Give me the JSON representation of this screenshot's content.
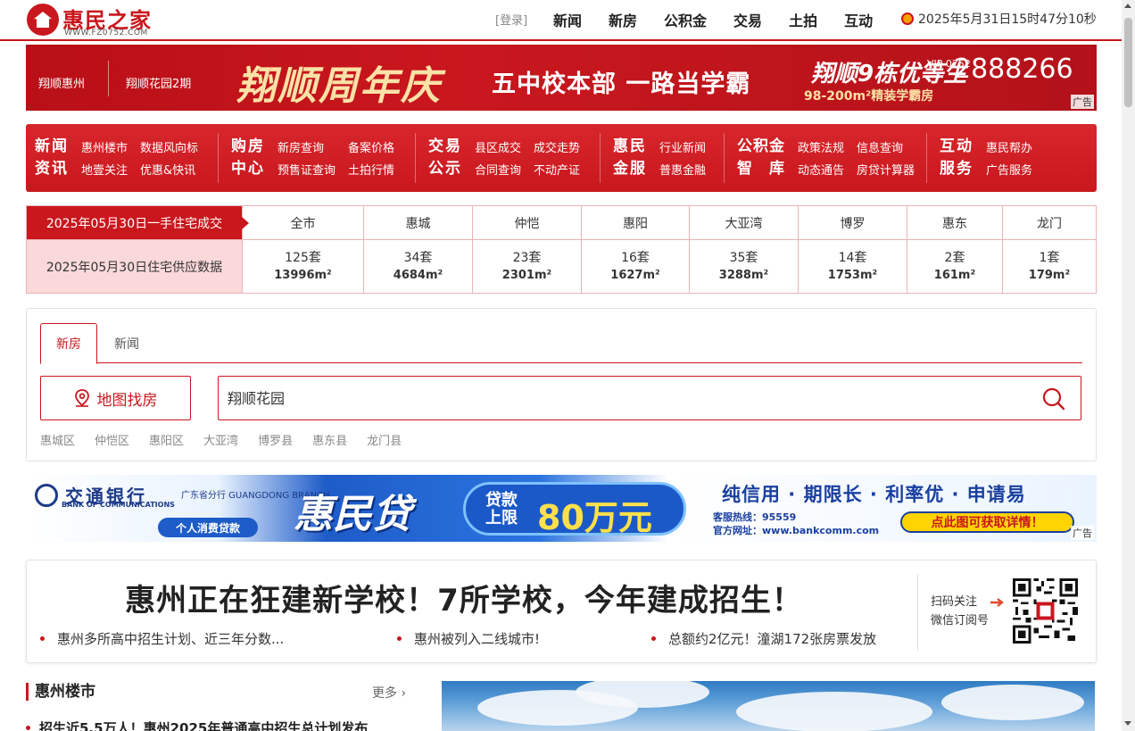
{
  "header": {
    "logo_name": "惠民之家",
    "logo_url": "WWW.FZ0752.COM",
    "login": "[登录]",
    "nav": [
      "新闻",
      "新房",
      "公积金",
      "交易",
      "土拍",
      "互动"
    ],
    "datetime": "2025年5月31日15时47分10秒"
  },
  "banner1": {
    "brand_left": "翔顺惠州",
    "brand_right": "翔顺花园2期",
    "main": "翔顺周年庆",
    "mid": "五中校本部 一路当学霸",
    "right_title": "翔顺9栋优等生",
    "vip": "VIP 0752",
    "phone": "2888266",
    "sub": "98-200m²精装学霸房",
    "ad_tag": "广告"
  },
  "category_nav": [
    {
      "title1": "新闻",
      "title2": "资讯",
      "links": [
        "惠州楼市",
        "数据风向标",
        "地壹关注",
        "优惠&快讯"
      ]
    },
    {
      "title1": "购房",
      "title2": "中心",
      "links": [
        "新房查询",
        "备案价格",
        "预售证查询",
        "土拍行情"
      ]
    },
    {
      "title1": "交易",
      "title2": "公示",
      "links": [
        "县区成交",
        "成交走势",
        "合同查询",
        "不动产证"
      ]
    },
    {
      "title1": "惠民",
      "title2": "金服",
      "links": [
        "行业新闻",
        "普惠金融"
      ]
    },
    {
      "title1": "公积金",
      "title2": "智　库",
      "links": [
        "政策法规",
        "信息查询",
        "动态通告",
        "房贷计算器"
      ]
    },
    {
      "title1": "互动",
      "title2": "服务",
      "links": [
        "惠民帮办",
        "广告服务"
      ]
    }
  ],
  "data_table": {
    "row1_head": "2025年05月30日一手住宅成交",
    "row2_head": "2025年05月30日住宅供应数据",
    "columns": [
      {
        "name": "全市",
        "units": "125套",
        "area": "13996m²"
      },
      {
        "name": "惠城",
        "units": "34套",
        "area": "4684m²"
      },
      {
        "name": "仲恺",
        "units": "23套",
        "area": "2301m²"
      },
      {
        "name": "惠阳",
        "units": "16套",
        "area": "1627m²"
      },
      {
        "name": "大亚湾",
        "units": "35套",
        "area": "3288m²"
      },
      {
        "name": "博罗",
        "units": "14套",
        "area": "1753m²"
      },
      {
        "name": "惠东",
        "units": "2套",
        "area": "161m²"
      },
      {
        "name": "龙门",
        "units": "1套",
        "area": "179m²"
      }
    ]
  },
  "search": {
    "tabs": [
      "新房",
      "新闻"
    ],
    "map_button": "地图找房",
    "value": "翔顺花园",
    "districts": [
      "惠城区",
      "仲恺区",
      "惠阳区",
      "大亚湾",
      "博罗县",
      "惠东县",
      "龙门县"
    ]
  },
  "banner2": {
    "bank_name": "交通银行",
    "bank_en": "BANK OF COMMUNICATIONS",
    "province": "广东省分行 GUANGDONG BRANCH",
    "tag": "个人消费贷款",
    "main": "惠民贷",
    "loan_label": "贷款上限",
    "loan_amount": "80万元",
    "slogan": "纯信用 · 期限长 · 利率优 · 申请易",
    "hotline": "客服热线：95559",
    "site": "官方网址：www.bankcomm.com",
    "cta": "点此图可获取详情！",
    "ad_tag": "广告"
  },
  "headline": {
    "title": "惠州正在狂建新学校！7所学校，今年建成招生！",
    "links": [
      "惠州多所高中招生计划、近三年分数...",
      "惠州被列入二线城市!",
      "总额约2亿元！潼湖172张房票发放"
    ],
    "qr_text1": "扫码关注",
    "qr_text2": "微信订阅号"
  },
  "section": {
    "title": "惠州楼市",
    "more": "更多",
    "first_news": "招生近5.5万人！惠州2025年普通高中招生总计划发布"
  }
}
